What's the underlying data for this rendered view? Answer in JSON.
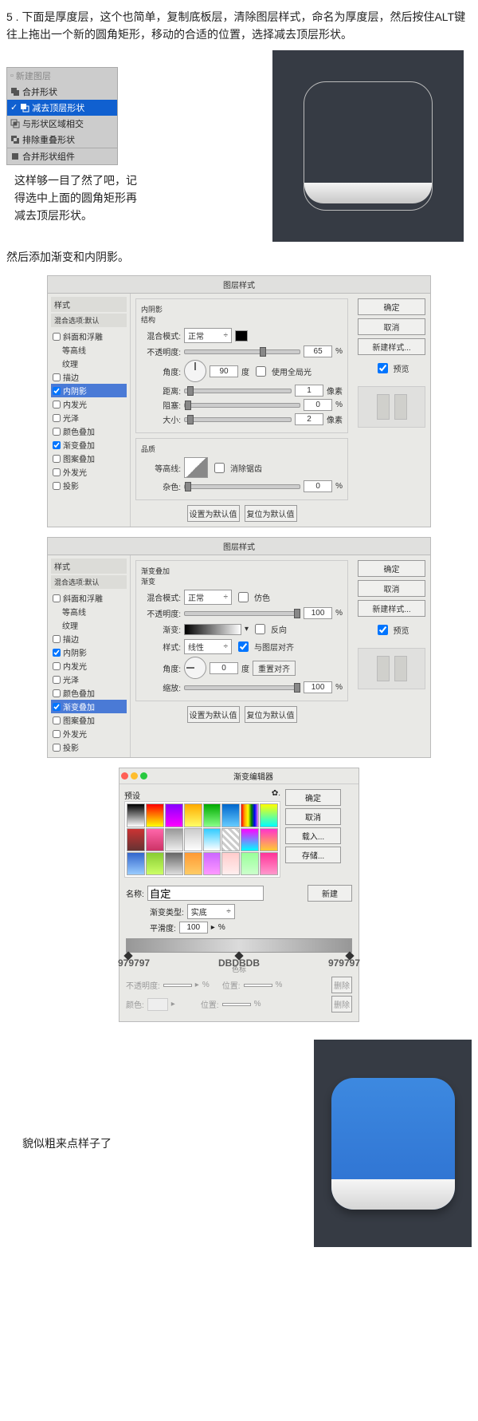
{
  "intro": "5 . 下面是厚度层，这个也简单，复制底板层，清除图层样式，命名为厚度层，然后按住ALT键往上拖出一个新的圆角矩形，移动的合适的位置，选择减去顶层形状。",
  "menu": {
    "items": [
      "新建图层",
      "合并形状",
      "减去顶层形状",
      "与形状区域相交",
      "排除重叠形状",
      "合并形状组件"
    ],
    "selected": 2
  },
  "note": "这样够一目了然了吧，记得选中上面的圆角矩形再减去顶层形状。",
  "p2": "然后添加渐变和内阴影。",
  "layerStyle": {
    "title": "图层样式",
    "leftHeader": "样式",
    "leftSub": "混合选项:默认",
    "effects": [
      "斜面和浮雕",
      "等高线",
      "纹理",
      "描边",
      "内阴影",
      "内发光",
      "光泽",
      "颜色叠加",
      "渐变叠加",
      "图案叠加",
      "外发光",
      "投影"
    ],
    "buttons": {
      "ok": "确定",
      "cancel": "取消",
      "newStyle": "新建样式...",
      "preview": "预览"
    }
  },
  "innerShadow": {
    "group1": "内阴影",
    "struct": "结构",
    "quality": "品质",
    "blendMode": "混合模式:",
    "blendVal": "正常",
    "opacity": "不透明度:",
    "opacityVal": "65",
    "pct": "%",
    "angle": "角度:",
    "angleVal": "90",
    "deg": "度",
    "global": "使用全局光",
    "distance": "距离:",
    "distanceVal": "1",
    "px": "像素",
    "choke": "阻塞:",
    "chokeVal": "0",
    "size": "大小:",
    "sizeVal": "2",
    "contour": "等高线:",
    "anti": "消除锯齿",
    "noise": "杂色:",
    "noiseVal": "0",
    "setDefault": "设置为默认值",
    "reset": "复位为默认值",
    "checked": [
      "内阴影",
      "渐变叠加"
    ],
    "sel": "内阴影"
  },
  "gradOverlay": {
    "group": "渐变叠加",
    "sub": "渐变",
    "blendMode": "混合模式:",
    "blendVal": "正常",
    "dither": "仿色",
    "opacity": "不透明度:",
    "opacityVal": "100",
    "pct": "%",
    "grad": "渐变:",
    "reverse": "反向",
    "style": "样式:",
    "styleVal": "线性",
    "align": "与图层对齐",
    "angle": "角度:",
    "angleVal": "0",
    "resetAlign": "重置对齐",
    "scale": "缩放:",
    "scaleVal": "100",
    "setDefault": "设置为默认值",
    "reset": "复位为默认值",
    "checked": [
      "内阴影",
      "渐变叠加"
    ],
    "sel": "渐变叠加"
  },
  "gradEditor": {
    "title": "渐变编辑器",
    "presets": "预设",
    "ok": "确定",
    "cancel": "取消",
    "load": "载入...",
    "save": "存储...",
    "name": "名称:",
    "nameVal": "自定",
    "new": "新建",
    "type": "渐变类型:",
    "typeVal": "实底",
    "smooth": "平滑度:",
    "smoothVal": "100",
    "pct": "%",
    "stops": {
      "l": "979797",
      "m": "DBDBDB",
      "r": "979797"
    },
    "opLbl": "不透明度:",
    "posLbl": "位置:",
    "del": "删除",
    "colorLbl": "颜色:"
  },
  "final": "貌似粗来点样子了"
}
